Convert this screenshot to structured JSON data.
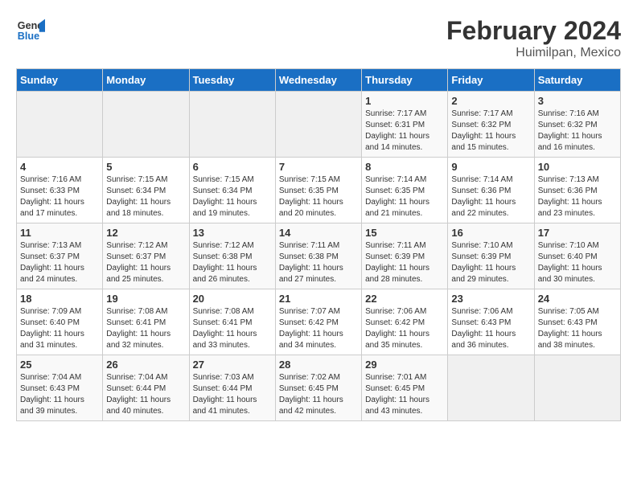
{
  "logo": {
    "line1": "General",
    "line2": "Blue"
  },
  "title": "February 2024",
  "subtitle": "Huimilpan, Mexico",
  "days_header": [
    "Sunday",
    "Monday",
    "Tuesday",
    "Wednesday",
    "Thursday",
    "Friday",
    "Saturday"
  ],
  "weeks": [
    [
      {
        "day": "",
        "info": ""
      },
      {
        "day": "",
        "info": ""
      },
      {
        "day": "",
        "info": ""
      },
      {
        "day": "",
        "info": ""
      },
      {
        "day": "1",
        "info": "Sunrise: 7:17 AM\nSunset: 6:31 PM\nDaylight: 11 hours\nand 14 minutes."
      },
      {
        "day": "2",
        "info": "Sunrise: 7:17 AM\nSunset: 6:32 PM\nDaylight: 11 hours\nand 15 minutes."
      },
      {
        "day": "3",
        "info": "Sunrise: 7:16 AM\nSunset: 6:32 PM\nDaylight: 11 hours\nand 16 minutes."
      }
    ],
    [
      {
        "day": "4",
        "info": "Sunrise: 7:16 AM\nSunset: 6:33 PM\nDaylight: 11 hours\nand 17 minutes."
      },
      {
        "day": "5",
        "info": "Sunrise: 7:15 AM\nSunset: 6:34 PM\nDaylight: 11 hours\nand 18 minutes."
      },
      {
        "day": "6",
        "info": "Sunrise: 7:15 AM\nSunset: 6:34 PM\nDaylight: 11 hours\nand 19 minutes."
      },
      {
        "day": "7",
        "info": "Sunrise: 7:15 AM\nSunset: 6:35 PM\nDaylight: 11 hours\nand 20 minutes."
      },
      {
        "day": "8",
        "info": "Sunrise: 7:14 AM\nSunset: 6:35 PM\nDaylight: 11 hours\nand 21 minutes."
      },
      {
        "day": "9",
        "info": "Sunrise: 7:14 AM\nSunset: 6:36 PM\nDaylight: 11 hours\nand 22 minutes."
      },
      {
        "day": "10",
        "info": "Sunrise: 7:13 AM\nSunset: 6:36 PM\nDaylight: 11 hours\nand 23 minutes."
      }
    ],
    [
      {
        "day": "11",
        "info": "Sunrise: 7:13 AM\nSunset: 6:37 PM\nDaylight: 11 hours\nand 24 minutes."
      },
      {
        "day": "12",
        "info": "Sunrise: 7:12 AM\nSunset: 6:37 PM\nDaylight: 11 hours\nand 25 minutes."
      },
      {
        "day": "13",
        "info": "Sunrise: 7:12 AM\nSunset: 6:38 PM\nDaylight: 11 hours\nand 26 minutes."
      },
      {
        "day": "14",
        "info": "Sunrise: 7:11 AM\nSunset: 6:38 PM\nDaylight: 11 hours\nand 27 minutes."
      },
      {
        "day": "15",
        "info": "Sunrise: 7:11 AM\nSunset: 6:39 PM\nDaylight: 11 hours\nand 28 minutes."
      },
      {
        "day": "16",
        "info": "Sunrise: 7:10 AM\nSunset: 6:39 PM\nDaylight: 11 hours\nand 29 minutes."
      },
      {
        "day": "17",
        "info": "Sunrise: 7:10 AM\nSunset: 6:40 PM\nDaylight: 11 hours\nand 30 minutes."
      }
    ],
    [
      {
        "day": "18",
        "info": "Sunrise: 7:09 AM\nSunset: 6:40 PM\nDaylight: 11 hours\nand 31 minutes."
      },
      {
        "day": "19",
        "info": "Sunrise: 7:08 AM\nSunset: 6:41 PM\nDaylight: 11 hours\nand 32 minutes."
      },
      {
        "day": "20",
        "info": "Sunrise: 7:08 AM\nSunset: 6:41 PM\nDaylight: 11 hours\nand 33 minutes."
      },
      {
        "day": "21",
        "info": "Sunrise: 7:07 AM\nSunset: 6:42 PM\nDaylight: 11 hours\nand 34 minutes."
      },
      {
        "day": "22",
        "info": "Sunrise: 7:06 AM\nSunset: 6:42 PM\nDaylight: 11 hours\nand 35 minutes."
      },
      {
        "day": "23",
        "info": "Sunrise: 7:06 AM\nSunset: 6:43 PM\nDaylight: 11 hours\nand 36 minutes."
      },
      {
        "day": "24",
        "info": "Sunrise: 7:05 AM\nSunset: 6:43 PM\nDaylight: 11 hours\nand 38 minutes."
      }
    ],
    [
      {
        "day": "25",
        "info": "Sunrise: 7:04 AM\nSunset: 6:43 PM\nDaylight: 11 hours\nand 39 minutes."
      },
      {
        "day": "26",
        "info": "Sunrise: 7:04 AM\nSunset: 6:44 PM\nDaylight: 11 hours\nand 40 minutes."
      },
      {
        "day": "27",
        "info": "Sunrise: 7:03 AM\nSunset: 6:44 PM\nDaylight: 11 hours\nand 41 minutes."
      },
      {
        "day": "28",
        "info": "Sunrise: 7:02 AM\nSunset: 6:45 PM\nDaylight: 11 hours\nand 42 minutes."
      },
      {
        "day": "29",
        "info": "Sunrise: 7:01 AM\nSunset: 6:45 PM\nDaylight: 11 hours\nand 43 minutes."
      },
      {
        "day": "",
        "info": ""
      },
      {
        "day": "",
        "info": ""
      }
    ]
  ]
}
